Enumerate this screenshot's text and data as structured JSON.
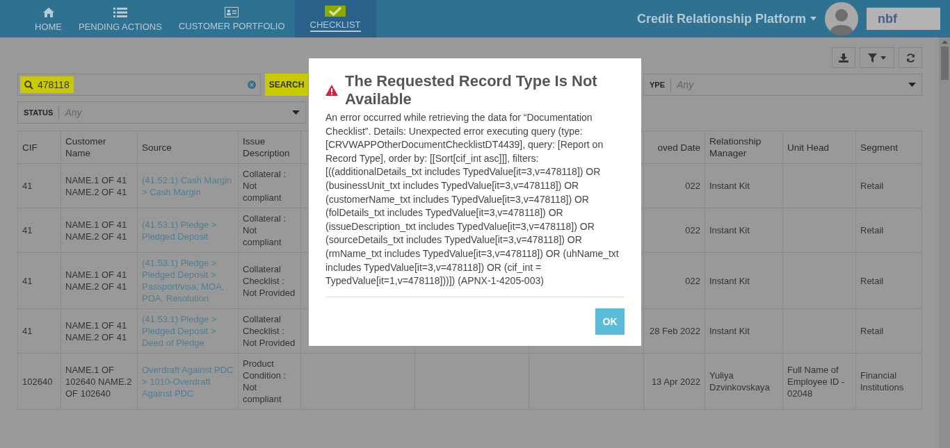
{
  "nav": {
    "tabs": [
      {
        "label": "HOME",
        "selected": false,
        "highlighted": false
      },
      {
        "label": "PENDING ACTIONS",
        "selected": false,
        "highlighted": false
      },
      {
        "label": "CUSTOMER PORTFOLIO",
        "selected": false,
        "highlighted": false
      },
      {
        "label": "CHECKLIST",
        "selected": true,
        "highlighted": true
      }
    ],
    "app_title": "Credit Relationship Platform",
    "logo": "nbf"
  },
  "filters": {
    "search": {
      "value": "478118",
      "highlighted": true
    },
    "search_button": {
      "label": "SEARCH",
      "highlighted": true
    },
    "type_filter": {
      "label": "YPE",
      "placeholder": "Any"
    },
    "status_filter": {
      "label": "STATUS",
      "placeholder": "Any"
    }
  },
  "table": {
    "columns": [
      "CIF",
      "Customer Name",
      "Source",
      "Issue Description",
      "oved Date",
      "Relationship Manager",
      "Unit Head",
      "Segment"
    ],
    "rows": [
      {
        "cif": "41",
        "customer_name": "NAME.1 OF 41 NAME.2 OF 41",
        "source": "(41.52.1) Cash Margin > Cash Margin",
        "issue_description": "Collateral : Not compliant",
        "approved_date": "022",
        "relationship_manager": "Instant Kit",
        "unit_head": "",
        "segment": "Retail"
      },
      {
        "cif": "41",
        "customer_name": "NAME.1 OF 41 NAME.2 OF 41",
        "source": "(41.53.1) Pledge > Pledged Deposit",
        "issue_description": "Collateral : Not compliant",
        "approved_date": "022",
        "relationship_manager": "Instant Kit",
        "unit_head": "",
        "segment": "Retail"
      },
      {
        "cif": "41",
        "customer_name": "NAME.1 OF 41 NAME.2 OF 41",
        "source": "(41.53.1) Pledge > Pledged Deposit > Passport/visa, MOA, POA, Resolution",
        "issue_description": "Collateral Checklist : Not Provided",
        "approved_date": "022",
        "relationship_manager": "Instant Kit",
        "unit_head": "",
        "segment": "Retail"
      },
      {
        "cif": "41",
        "customer_name": "NAME.1 OF 41 NAME.2 OF 41",
        "source": "(41.53.1) Pledge > Pledged Deposit > Deed of Pledge",
        "issue_description": "Collateral Checklist : Not Provided",
        "approved_date": "28 Feb 2022",
        "relationship_manager": "Instant Kit",
        "unit_head": "",
        "segment": "Retail"
      },
      {
        "cif": "102640",
        "customer_name": "NAME.1 OF 102640 NAME.2 OF 102640",
        "source": "Overdraft Against PDC > 1010-Overdraft Against PDC",
        "issue_description": "Product Condition : Not compliant",
        "approved_date": "13 Apr 2022",
        "relationship_manager": "Yuliya Dzvinkovskaya",
        "unit_head": "Full Name of Employee ID - 02048",
        "segment": "Financial Institutions"
      }
    ]
  },
  "dialog": {
    "title": "The Requested Record Type Is Not Available",
    "message": "An error occurred while retrieving the data for “Documentation Checklist”. Details: Unexpected error executing query (type: [CRVWAPPOtherDocumentChecklistDT4439], query: [Report on Record Type], order by: [[Sort[cif_int asc]]], filters: [((additionalDetails_txt includes TypedValue[it=3,v=478118]) OR (businessUnit_txt includes TypedValue[it=3,v=478118]) OR (customerName_txt includes TypedValue[it=3,v=478118]) OR (folDetails_txt includes TypedValue[it=3,v=478118]) OR (issueDescription_txt includes TypedValue[it=3,v=478118]) OR (sourceDetails_txt includes TypedValue[it=3,v=478118]) OR (rmName_txt includes TypedValue[it=3,v=478118]) OR (uhName_txt includes TypedValue[it=3,v=478118]) OR (cif_int = TypedValue[it=1,v=478118]))]) (APNX-1-4205-003)",
    "ok_button": "OK"
  }
}
